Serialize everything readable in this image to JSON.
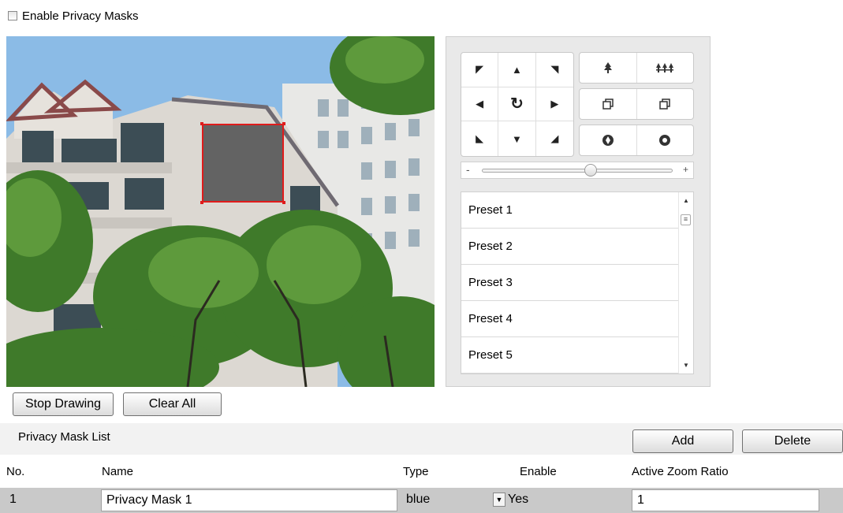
{
  "enable_privacy_masks": {
    "label": "Enable Privacy Masks",
    "checked": false
  },
  "ptz": {
    "directions": [
      {
        "name": "up-left",
        "icon": "arrow-up-left-icon",
        "glyph": "◤"
      },
      {
        "name": "up",
        "icon": "arrow-up-icon",
        "glyph": "▲"
      },
      {
        "name": "up-right",
        "icon": "arrow-up-right-icon",
        "glyph": "◥"
      },
      {
        "name": "left",
        "icon": "arrow-left-icon",
        "glyph": "◀"
      },
      {
        "name": "auto",
        "icon": "auto-rotate-icon",
        "glyph": "↻"
      },
      {
        "name": "right",
        "icon": "arrow-right-icon",
        "glyph": "▶"
      },
      {
        "name": "down-left",
        "icon": "arrow-down-left-icon",
        "glyph": "◣"
      },
      {
        "name": "down",
        "icon": "arrow-down-icon",
        "glyph": "▼"
      },
      {
        "name": "down-right",
        "icon": "arrow-down-right-icon",
        "glyph": "◢"
      }
    ],
    "zoom_icons": {
      "in": "zoom-in-tree-icon",
      "out": "zoom-out-trees-icon"
    },
    "focus_icons": {
      "near": "focus-near-icon",
      "far": "focus-far-icon"
    },
    "iris_icons": {
      "open": "iris-open-icon",
      "close": "iris-close-icon"
    },
    "speed": {
      "minus": "-",
      "plus": "+",
      "level_fraction": 0.6
    },
    "presets": [
      "Preset 1",
      "Preset 2",
      "Preset 3",
      "Preset 4",
      "Preset 5"
    ]
  },
  "drawing": {
    "stop_label": "Stop Drawing",
    "clear_label": "Clear All"
  },
  "mask_list": {
    "title": "Privacy Mask List",
    "add_label": "Add",
    "delete_label": "Delete",
    "columns": {
      "no": "No.",
      "name": "Name",
      "type": "Type",
      "enable": "Enable",
      "zoom": "Active Zoom Ratio"
    },
    "rows": [
      {
        "no": "1",
        "name": "Privacy Mask 1",
        "type": "blue",
        "enable": "Yes",
        "zoom": "1"
      }
    ]
  },
  "colors": {
    "mask_fill": "#636363",
    "mask_border": "#e01b1b",
    "row_bg": "#c9c9c9"
  }
}
